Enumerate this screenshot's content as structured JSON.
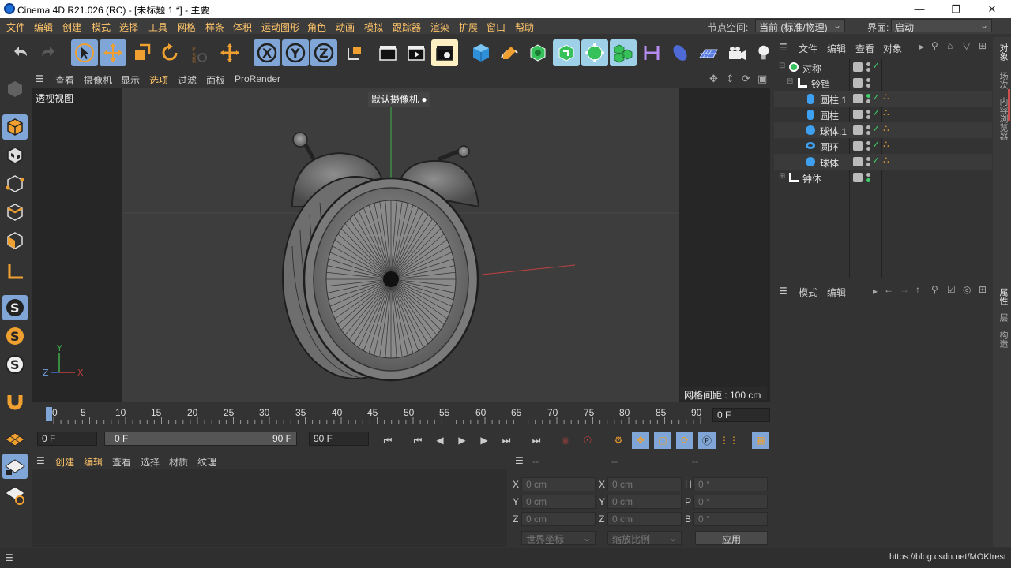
{
  "window": {
    "title": "Cinema 4D R21.026 (RC) - [未标题 1 *] - 主要"
  },
  "menu": [
    "文件",
    "编辑",
    "创建",
    "模式",
    "选择",
    "工具",
    "网格",
    "样条",
    "体积",
    "运动图形",
    "角色",
    "动画",
    "模拟",
    "跟踪器",
    "渲染",
    "扩展",
    "窗口",
    "帮助"
  ],
  "node_space": {
    "label": "节点空间:",
    "value": "当前 (标准/物理)"
  },
  "interface": {
    "label": "界面:",
    "value": "启动"
  },
  "viewport": {
    "menu": [
      "查看",
      "摄像机",
      "显示",
      "选项",
      "过滤",
      "面板",
      "ProRender"
    ],
    "view_name": "透视视图",
    "camera": "默认摄像机",
    "grid_info": "网格间距 : 100 cm"
  },
  "timeline": {
    "ticks": [
      "0",
      "5",
      "10",
      "15",
      "20",
      "25",
      "30",
      "35",
      "40",
      "45",
      "50",
      "55",
      "60",
      "65",
      "70",
      "75",
      "80",
      "85",
      "90"
    ],
    "current_frame": "0 F",
    "start": "0 F",
    "range_start": "0 F",
    "range_end": "90 F",
    "end": "90 F"
  },
  "material_panel": {
    "menu": [
      "创建",
      "编辑",
      "查看",
      "选择",
      "材质",
      "纹理"
    ]
  },
  "coords": {
    "headers": [
      "--",
      "--",
      "--"
    ],
    "rows": [
      {
        "a_label": "X",
        "a_val": "0 cm",
        "b_label": "X",
        "b_val": "0 cm",
        "c_label": "H",
        "c_val": "0 °"
      },
      {
        "a_label": "Y",
        "a_val": "0 cm",
        "b_label": "Y",
        "b_val": "0 cm",
        "c_label": "P",
        "c_val": "0 °"
      },
      {
        "a_label": "Z",
        "a_val": "0 cm",
        "b_label": "Z",
        "b_val": "0 cm",
        "c_label": "B",
        "c_val": "0 °"
      }
    ],
    "world": "世界坐标",
    "scale": "缩放比例",
    "apply": "应用"
  },
  "object_panel": {
    "menu": [
      "文件",
      "编辑",
      "查看",
      "对象"
    ],
    "objects": [
      {
        "name": "对称",
        "icon": "symmetry-icon"
      },
      {
        "name": "铃铛",
        "icon": "null-icon"
      },
      {
        "name": "圆柱.1",
        "icon": "cylinder-icon"
      },
      {
        "name": "圆柱",
        "icon": "cylinder-icon"
      },
      {
        "name": "球体.1",
        "icon": "sphere-icon"
      },
      {
        "name": "圆环",
        "icon": "torus-icon"
      },
      {
        "name": "球体",
        "icon": "sphere-icon"
      },
      {
        "name": "钟体",
        "icon": "null-icon"
      }
    ]
  },
  "attr_panel": {
    "menu": [
      "模式",
      "编辑"
    ]
  },
  "right_tabs": {
    "top": [
      "对象",
      "场次",
      "内容浏览器"
    ],
    "bottom": [
      "属性",
      "层",
      "构造"
    ]
  },
  "status": {
    "url": "https://blog.csdn.net/MOKIrest"
  },
  "colors": {
    "accent_orange": "#ffc56a",
    "selected_blue": "#7fa6d6",
    "viewport_bg": "#3d3d3d"
  }
}
